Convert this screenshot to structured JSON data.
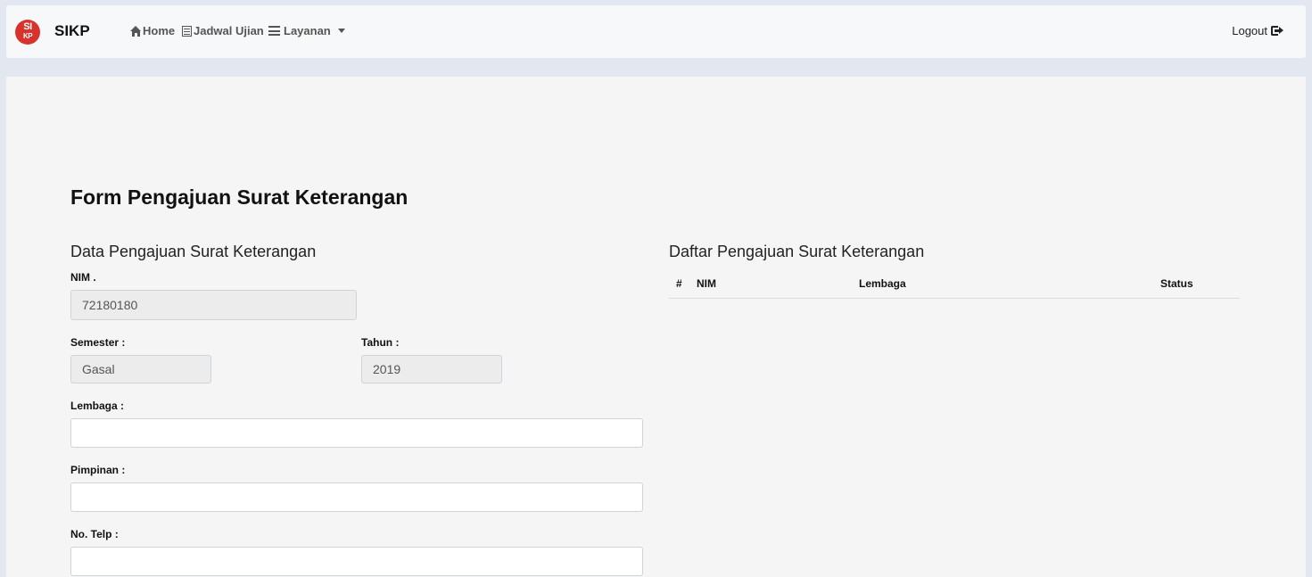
{
  "navbar": {
    "logo_top": "SI",
    "logo_bottom": "KP",
    "brand": "SIKP",
    "items": [
      {
        "label": "Home",
        "icon": "home-icon"
      },
      {
        "label": "Jadwal Ujian",
        "icon": "calendar-icon"
      },
      {
        "label": "Layanan",
        "icon": "list-icon"
      }
    ],
    "logout_label": "Logout",
    "logout_icon": "logout-icon"
  },
  "page": {
    "title": "Form Pengajuan Surat Keterangan"
  },
  "form": {
    "section_title": "Data Pengajuan Surat Keterangan",
    "nim_label": "NIM .",
    "nim_value": "72180180",
    "semester_label": "Semester :",
    "semester_value": "Gasal",
    "tahun_label": "Tahun :",
    "tahun_value": "2019",
    "lembaga_label": "Lembaga :",
    "lembaga_value": "",
    "pimpinan_label": "Pimpinan :",
    "pimpinan_value": "",
    "telp_label": "No. Telp :",
    "telp_value": ""
  },
  "list": {
    "section_title": "Daftar Pengajuan Surat Keterangan",
    "columns": [
      "#",
      "NIM",
      "Lembaga",
      "Status"
    ],
    "rows": []
  },
  "colors": {
    "brand_red": "#d7332c",
    "page_bg": "#e3e8f0",
    "content_bg": "#f4f5f4"
  }
}
